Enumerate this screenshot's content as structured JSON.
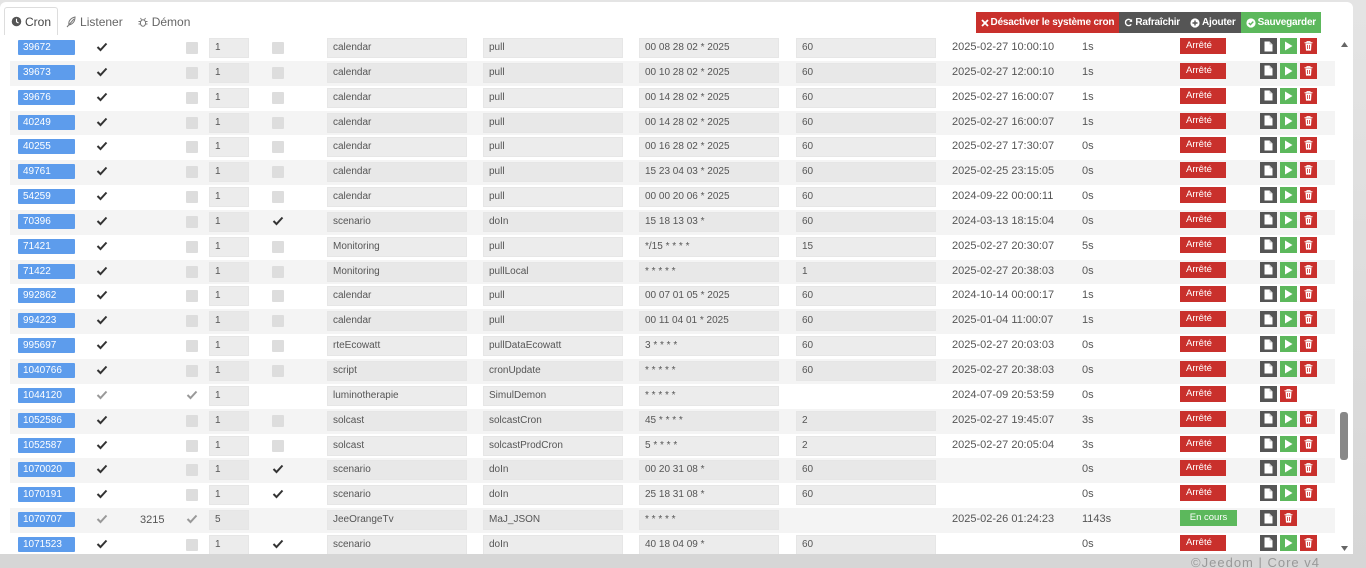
{
  "tabs": [
    {
      "label": "Cron",
      "icon": "clock-icon",
      "active": true
    },
    {
      "label": "Listener",
      "icon": "feather-icon",
      "active": false
    },
    {
      "label": "Démon",
      "icon": "bug-icon",
      "active": false
    }
  ],
  "actions": {
    "disable_label": "Désactiver le système cron",
    "refresh_label": "Rafraîchir",
    "add_label": "Ajouter",
    "save_label": "Sauvegarder"
  },
  "colors": {
    "id_badge": "#5d9cec",
    "stop": "#c9302c",
    "running": "#5cb85c",
    "doc": "#555555"
  },
  "rows": [
    {
      "id": "39672",
      "en": "check",
      "pid": "",
      "deamon": "square",
      "timeout": "1",
      "once": "square",
      "class": "calendar",
      "function": "pull",
      "schedule": "00 08 28 02 * 2025",
      "duration": "60",
      "last_run": "2025-02-27 10:00:10",
      "runtime": "1s",
      "state": "Arrêté",
      "stopped": true,
      "play": true
    },
    {
      "id": "39673",
      "en": "check",
      "pid": "",
      "deamon": "square",
      "timeout": "1",
      "once": "square",
      "class": "calendar",
      "function": "pull",
      "schedule": "00 10 28 02 * 2025",
      "duration": "60",
      "last_run": "2025-02-27 12:00:10",
      "runtime": "1s",
      "state": "Arrêté",
      "stopped": true,
      "play": true
    },
    {
      "id": "39676",
      "en": "check",
      "pid": "",
      "deamon": "square",
      "timeout": "1",
      "once": "square",
      "class": "calendar",
      "function": "pull",
      "schedule": "00 14 28 02 * 2025",
      "duration": "60",
      "last_run": "2025-02-27 16:00:07",
      "runtime": "1s",
      "state": "Arrêté",
      "stopped": true,
      "play": true
    },
    {
      "id": "40249",
      "en": "check",
      "pid": "",
      "deamon": "square",
      "timeout": "1",
      "once": "square",
      "class": "calendar",
      "function": "pull",
      "schedule": "00 14 28 02 * 2025",
      "duration": "60",
      "last_run": "2025-02-27 16:00:07",
      "runtime": "1s",
      "state": "Arrêté",
      "stopped": true,
      "play": true
    },
    {
      "id": "40255",
      "en": "check",
      "pid": "",
      "deamon": "square",
      "timeout": "1",
      "once": "square",
      "class": "calendar",
      "function": "pull",
      "schedule": "00 16 28 02 * 2025",
      "duration": "60",
      "last_run": "2025-02-27 17:30:07",
      "runtime": "0s",
      "state": "Arrêté",
      "stopped": true,
      "play": true
    },
    {
      "id": "49761",
      "en": "check",
      "pid": "",
      "deamon": "square",
      "timeout": "1",
      "once": "square",
      "class": "calendar",
      "function": "pull",
      "schedule": "15 23 04 03 * 2025",
      "duration": "60",
      "last_run": "2025-02-25 23:15:05",
      "runtime": "0s",
      "state": "Arrêté",
      "stopped": true,
      "play": true
    },
    {
      "id": "54259",
      "en": "check",
      "pid": "",
      "deamon": "square",
      "timeout": "1",
      "once": "square",
      "class": "calendar",
      "function": "pull",
      "schedule": "00 00 20 06 * 2025",
      "duration": "60",
      "last_run": "2024-09-22 00:00:11",
      "runtime": "0s",
      "state": "Arrêté",
      "stopped": true,
      "play": true
    },
    {
      "id": "70396",
      "en": "check",
      "pid": "",
      "deamon": "square",
      "timeout": "1",
      "once": "check",
      "class": "scenario",
      "function": "doIn",
      "schedule": "15 18 13 03 *",
      "duration": "60",
      "last_run": "2024-03-13 18:15:04",
      "runtime": "0s",
      "state": "Arrêté",
      "stopped": true,
      "play": true
    },
    {
      "id": "71421",
      "en": "check",
      "pid": "",
      "deamon": "square",
      "timeout": "1",
      "once": "square",
      "class": "Monitoring",
      "function": "pull",
      "schedule": "*/15 * * * *",
      "duration": "15",
      "last_run": "2025-02-27 20:30:07",
      "runtime": "5s",
      "state": "Arrêté",
      "stopped": true,
      "play": true
    },
    {
      "id": "71422",
      "en": "check",
      "pid": "",
      "deamon": "square",
      "timeout": "1",
      "once": "square",
      "class": "Monitoring",
      "function": "pullLocal",
      "schedule": "* * * * *",
      "duration": "1",
      "last_run": "2025-02-27 20:38:03",
      "runtime": "0s",
      "state": "Arrêté",
      "stopped": true,
      "play": true
    },
    {
      "id": "992862",
      "en": "check",
      "pid": "",
      "deamon": "square",
      "timeout": "1",
      "once": "square",
      "class": "calendar",
      "function": "pull",
      "schedule": "00 07 01 05 * 2025",
      "duration": "60",
      "last_run": "2024-10-14 00:00:17",
      "runtime": "1s",
      "state": "Arrêté",
      "stopped": true,
      "play": true
    },
    {
      "id": "994223",
      "en": "check",
      "pid": "",
      "deamon": "square",
      "timeout": "1",
      "once": "square",
      "class": "calendar",
      "function": "pull",
      "schedule": "00 11 04 01 * 2025",
      "duration": "60",
      "last_run": "2025-01-04 11:00:07",
      "runtime": "1s",
      "state": "Arrêté",
      "stopped": true,
      "play": true
    },
    {
      "id": "995697",
      "en": "check",
      "pid": "",
      "deamon": "square",
      "timeout": "1",
      "once": "square",
      "class": "rteEcowatt",
      "function": "pullDataEcowatt",
      "schedule": "3 * * * *",
      "duration": "60",
      "last_run": "2025-02-27 20:03:03",
      "runtime": "0s",
      "state": "Arrêté",
      "stopped": true,
      "play": true
    },
    {
      "id": "1040766",
      "en": "check",
      "pid": "",
      "deamon": "square",
      "timeout": "1",
      "once": "square",
      "class": "script",
      "function": "cronUpdate",
      "schedule": "* * * * *",
      "duration": "60",
      "last_run": "2025-02-27 20:38:03",
      "runtime": "0s",
      "state": "Arrêté",
      "stopped": true,
      "play": true
    },
    {
      "id": "1044120",
      "en": "check-light",
      "pid": "",
      "deamon": "check-light",
      "timeout": "1",
      "once": "none",
      "class": "luminotherapie",
      "function": "SimulDemon",
      "schedule": "* * * * *",
      "duration": "",
      "last_run": "2024-07-09 20:53:59",
      "runtime": "0s",
      "state": "Arrêté",
      "stopped": true,
      "play": false
    },
    {
      "id": "1052586",
      "en": "check",
      "pid": "",
      "deamon": "square",
      "timeout": "1",
      "once": "square",
      "class": "solcast",
      "function": "solcastCron",
      "schedule": "45 * * * *",
      "duration": "2",
      "last_run": "2025-02-27 19:45:07",
      "runtime": "3s",
      "state": "Arrêté",
      "stopped": true,
      "play": true
    },
    {
      "id": "1052587",
      "en": "check",
      "pid": "",
      "deamon": "square",
      "timeout": "1",
      "once": "square",
      "class": "solcast",
      "function": "solcastProdCron",
      "schedule": "5 * * * *",
      "duration": "2",
      "last_run": "2025-02-27 20:05:04",
      "runtime": "3s",
      "state": "Arrêté",
      "stopped": true,
      "play": true
    },
    {
      "id": "1070020",
      "en": "check",
      "pid": "",
      "deamon": "square",
      "timeout": "1",
      "once": "check",
      "class": "scenario",
      "function": "doIn",
      "schedule": "00 20 31 08 *",
      "duration": "60",
      "last_run": "",
      "runtime": "0s",
      "state": "Arrêté",
      "stopped": true,
      "play": true
    },
    {
      "id": "1070191",
      "en": "check",
      "pid": "",
      "deamon": "square",
      "timeout": "1",
      "once": "check",
      "class": "scenario",
      "function": "doIn",
      "schedule": "25 18 31 08 *",
      "duration": "60",
      "last_run": "",
      "runtime": "0s",
      "state": "Arrêté",
      "stopped": true,
      "play": true
    },
    {
      "id": "1070707",
      "en": "check-light",
      "pid": "3215",
      "deamon": "check-light",
      "timeout": "5",
      "once": "none",
      "class": "JeeOrangeTv",
      "function": "MaJ_JSON",
      "schedule": "* * * * *",
      "duration": "",
      "last_run": "2025-02-26 01:24:23",
      "runtime": "1143s",
      "state": "En cours",
      "stopped": false,
      "play": false
    },
    {
      "id": "1071523",
      "en": "check",
      "pid": "",
      "deamon": "square",
      "timeout": "1",
      "once": "check",
      "class": "scenario",
      "function": "doIn",
      "schedule": "40 18 04 09 *",
      "duration": "60",
      "last_run": "",
      "runtime": "0s",
      "state": "Arrêté",
      "stopped": true,
      "play": true
    }
  ],
  "footer": "©Jeedom | Core v4"
}
